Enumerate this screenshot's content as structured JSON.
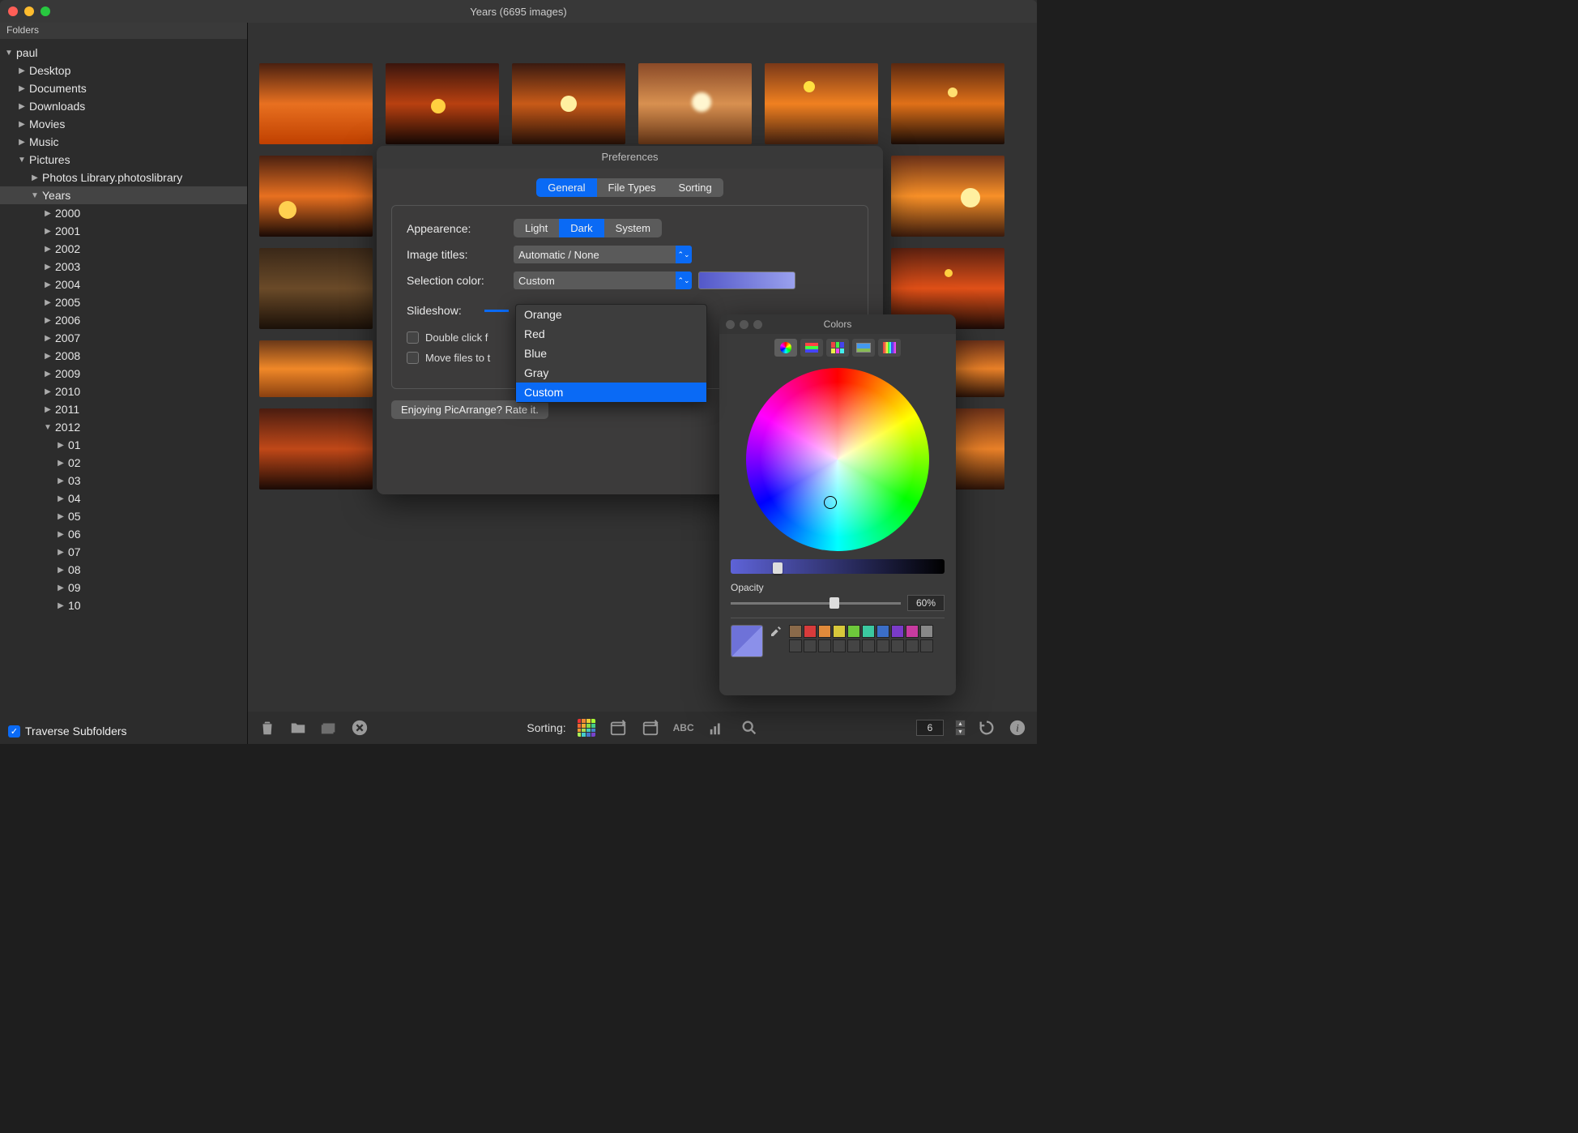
{
  "window_title": "Years (6695 images)",
  "sidebar": {
    "header": "Folders",
    "traverse_label": "Traverse Subfolders",
    "tree": {
      "root": "paul",
      "children": [
        "Desktop",
        "Documents",
        "Downloads",
        "Movies",
        "Music"
      ],
      "pictures": "Pictures",
      "photoslib": "Photos Library.photoslibrary",
      "years_label": "Years",
      "years": [
        "2000",
        "2001",
        "2002",
        "2003",
        "2004",
        "2005",
        "2006",
        "2007",
        "2008",
        "2009",
        "2010",
        "2011",
        "2012"
      ],
      "months": [
        "01",
        "02",
        "03",
        "04",
        "05",
        "06",
        "07",
        "08",
        "09",
        "10"
      ]
    }
  },
  "toolbar": {
    "sorting_label": "Sorting:",
    "columns_value": "6"
  },
  "preferences": {
    "title": "Preferences",
    "tabs": [
      "General",
      "File Types",
      "Sorting"
    ],
    "appearance_label": "Appearence:",
    "appearance_options": [
      "Light",
      "Dark",
      "System"
    ],
    "titles_label": "Image titles:",
    "titles_value": "Automatic / None",
    "selection_label": "Selection color:",
    "selection_value": "Custom",
    "slideshow_label": "Slideshow:",
    "doubleclick_label": "Double click f",
    "movefiles_label": "Move files to t",
    "rate_label": "Enjoying PicArrange? Rate it."
  },
  "selection_dropdown": [
    "Orange",
    "Red",
    "Blue",
    "Gray",
    "Custom"
  ],
  "colors_panel": {
    "title": "Colors",
    "opacity_label": "Opacity",
    "opacity_value": "60%",
    "swatches": [
      "#8a6a4a",
      "#d83b3b",
      "#e08a3b",
      "#d8c83b",
      "#6ec83b",
      "#3bc8a0",
      "#3b6ec8",
      "#7a3bc8",
      "#c83ba0",
      "#888",
      "#444",
      "#444",
      "#444",
      "#444",
      "#444",
      "#444",
      "#444",
      "#444",
      "#444",
      "#444"
    ]
  }
}
